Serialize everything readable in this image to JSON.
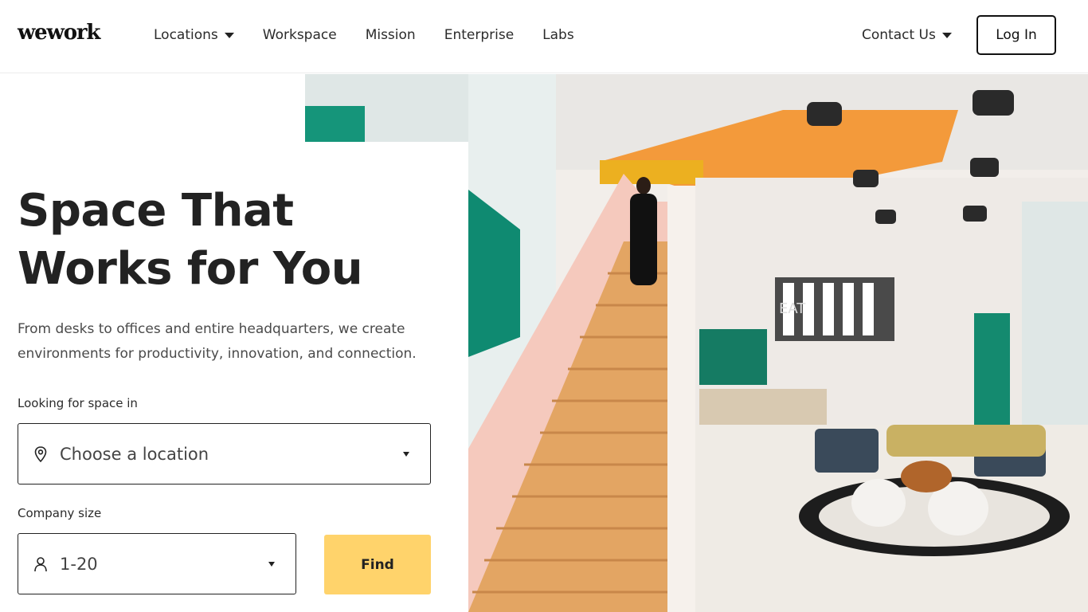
{
  "brand": {
    "logo_text": "wework"
  },
  "nav": {
    "links": [
      {
        "label": "Locations",
        "has_dropdown": true
      },
      {
        "label": "Workspace",
        "has_dropdown": false
      },
      {
        "label": "Mission",
        "has_dropdown": false
      },
      {
        "label": "Enterprise",
        "has_dropdown": false
      },
      {
        "label": "Labs",
        "has_dropdown": false
      }
    ],
    "contact_label": "Contact Us",
    "login_label": "Log In"
  },
  "hero": {
    "headline_line1": "Space That",
    "headline_line2": "Works for You",
    "subtext_line1": "From desks to offices and entire headquarters, we create",
    "subtext_line2": "environments for productivity, innovation, and connection.",
    "image_description_sign": "EAT"
  },
  "search": {
    "location_label": "Looking for space in",
    "location_placeholder": "Choose a location",
    "size_label": "Company size",
    "size_value": "1-20",
    "find_label": "Find"
  },
  "colors": {
    "accent_yellow": "#ffd36b",
    "text_dark": "#222222",
    "text_muted": "#4a4a4a",
    "border": "#222222"
  },
  "icons": {
    "location_field": "map-pin-icon",
    "size_field": "user-icon",
    "dropdown": "caret-down-icon"
  }
}
